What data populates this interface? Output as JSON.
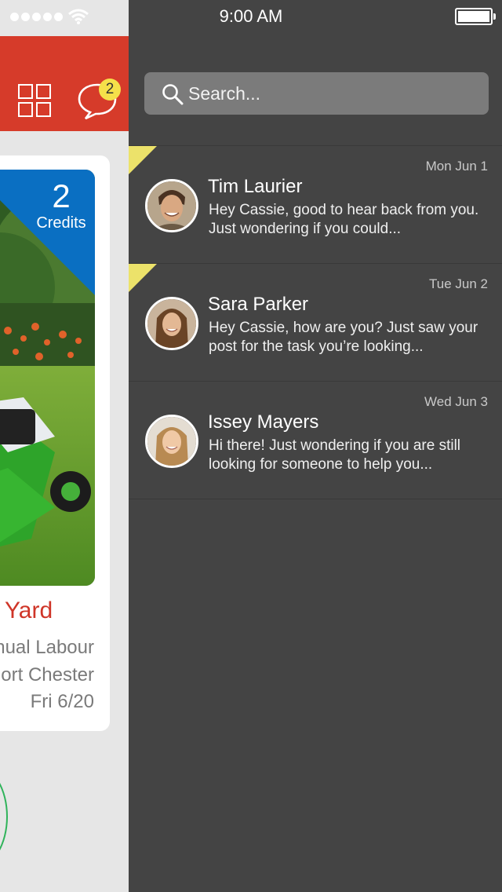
{
  "status_bar": {
    "time": "9:00 AM",
    "signal_icon": "signal-dots-icon",
    "wifi_icon": "wifi-icon",
    "battery_icon": "battery-icon"
  },
  "left_panel": {
    "header_color": "#d63b2a",
    "grid_icon": "grid-icon",
    "chat_icon": "chat-bubble-icon",
    "unread_count": "2",
    "task_card": {
      "credits_value": "2",
      "credits_label": "Credits",
      "credits_color": "#0a6fc2",
      "title": "Yard",
      "category": "nual Labour",
      "location": "ort Chester",
      "date": "Fri 6/20"
    }
  },
  "messages": {
    "search_placeholder": "Search...",
    "items": [
      {
        "date": "Mon Jun 1",
        "name": "Tim Laurier",
        "preview": "Hey Cassie, good to hear back from you. Just wondering if you could...",
        "unread": true
      },
      {
        "date": "Tue Jun 2",
        "name": "Sara Parker",
        "preview": "Hey Cassie, how are you? Just saw your post for the task you’re looking...",
        "unread": true
      },
      {
        "date": "Wed Jun 3",
        "name": "Issey Mayers",
        "preview": "Hi there! Just wondering if you are still looking for someone to help you...",
        "unread": false
      }
    ]
  },
  "colors": {
    "panel_background": "#444444",
    "unread_flag": "#ece26a",
    "search_field": "#7b7b7b"
  }
}
